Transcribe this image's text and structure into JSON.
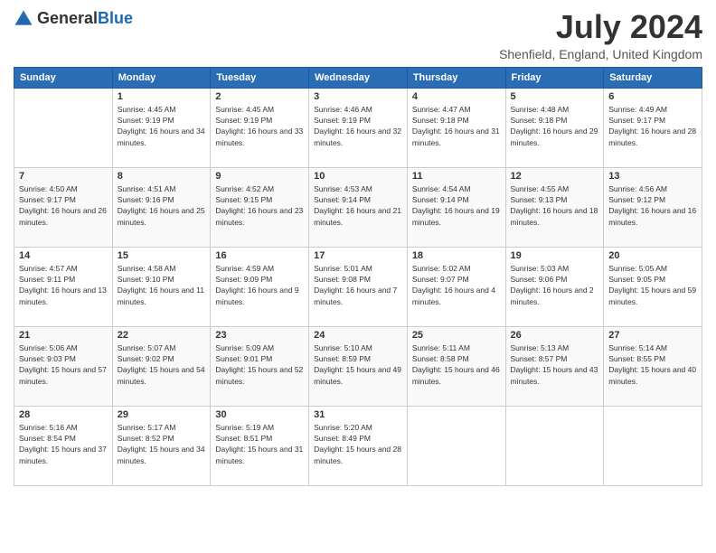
{
  "logo": {
    "general": "General",
    "blue": "Blue"
  },
  "title": "July 2024",
  "location": "Shenfield, England, United Kingdom",
  "headers": [
    "Sunday",
    "Monday",
    "Tuesday",
    "Wednesday",
    "Thursday",
    "Friday",
    "Saturday"
  ],
  "weeks": [
    [
      {
        "day": "",
        "sunrise": "",
        "sunset": "",
        "daylight": ""
      },
      {
        "day": "1",
        "sunrise": "Sunrise: 4:45 AM",
        "sunset": "Sunset: 9:19 PM",
        "daylight": "Daylight: 16 hours and 34 minutes."
      },
      {
        "day": "2",
        "sunrise": "Sunrise: 4:45 AM",
        "sunset": "Sunset: 9:19 PM",
        "daylight": "Daylight: 16 hours and 33 minutes."
      },
      {
        "day": "3",
        "sunrise": "Sunrise: 4:46 AM",
        "sunset": "Sunset: 9:19 PM",
        "daylight": "Daylight: 16 hours and 32 minutes."
      },
      {
        "day": "4",
        "sunrise": "Sunrise: 4:47 AM",
        "sunset": "Sunset: 9:18 PM",
        "daylight": "Daylight: 16 hours and 31 minutes."
      },
      {
        "day": "5",
        "sunrise": "Sunrise: 4:48 AM",
        "sunset": "Sunset: 9:18 PM",
        "daylight": "Daylight: 16 hours and 29 minutes."
      },
      {
        "day": "6",
        "sunrise": "Sunrise: 4:49 AM",
        "sunset": "Sunset: 9:17 PM",
        "daylight": "Daylight: 16 hours and 28 minutes."
      }
    ],
    [
      {
        "day": "7",
        "sunrise": "Sunrise: 4:50 AM",
        "sunset": "Sunset: 9:17 PM",
        "daylight": "Daylight: 16 hours and 26 minutes."
      },
      {
        "day": "8",
        "sunrise": "Sunrise: 4:51 AM",
        "sunset": "Sunset: 9:16 PM",
        "daylight": "Daylight: 16 hours and 25 minutes."
      },
      {
        "day": "9",
        "sunrise": "Sunrise: 4:52 AM",
        "sunset": "Sunset: 9:15 PM",
        "daylight": "Daylight: 16 hours and 23 minutes."
      },
      {
        "day": "10",
        "sunrise": "Sunrise: 4:53 AM",
        "sunset": "Sunset: 9:14 PM",
        "daylight": "Daylight: 16 hours and 21 minutes."
      },
      {
        "day": "11",
        "sunrise": "Sunrise: 4:54 AM",
        "sunset": "Sunset: 9:14 PM",
        "daylight": "Daylight: 16 hours and 19 minutes."
      },
      {
        "day": "12",
        "sunrise": "Sunrise: 4:55 AM",
        "sunset": "Sunset: 9:13 PM",
        "daylight": "Daylight: 16 hours and 18 minutes."
      },
      {
        "day": "13",
        "sunrise": "Sunrise: 4:56 AM",
        "sunset": "Sunset: 9:12 PM",
        "daylight": "Daylight: 16 hours and 16 minutes."
      }
    ],
    [
      {
        "day": "14",
        "sunrise": "Sunrise: 4:57 AM",
        "sunset": "Sunset: 9:11 PM",
        "daylight": "Daylight: 16 hours and 13 minutes."
      },
      {
        "day": "15",
        "sunrise": "Sunrise: 4:58 AM",
        "sunset": "Sunset: 9:10 PM",
        "daylight": "Daylight: 16 hours and 11 minutes."
      },
      {
        "day": "16",
        "sunrise": "Sunrise: 4:59 AM",
        "sunset": "Sunset: 9:09 PM",
        "daylight": "Daylight: 16 hours and 9 minutes."
      },
      {
        "day": "17",
        "sunrise": "Sunrise: 5:01 AM",
        "sunset": "Sunset: 9:08 PM",
        "daylight": "Daylight: 16 hours and 7 minutes."
      },
      {
        "day": "18",
        "sunrise": "Sunrise: 5:02 AM",
        "sunset": "Sunset: 9:07 PM",
        "daylight": "Daylight: 16 hours and 4 minutes."
      },
      {
        "day": "19",
        "sunrise": "Sunrise: 5:03 AM",
        "sunset": "Sunset: 9:06 PM",
        "daylight": "Daylight: 16 hours and 2 minutes."
      },
      {
        "day": "20",
        "sunrise": "Sunrise: 5:05 AM",
        "sunset": "Sunset: 9:05 PM",
        "daylight": "Daylight: 15 hours and 59 minutes."
      }
    ],
    [
      {
        "day": "21",
        "sunrise": "Sunrise: 5:06 AM",
        "sunset": "Sunset: 9:03 PM",
        "daylight": "Daylight: 15 hours and 57 minutes."
      },
      {
        "day": "22",
        "sunrise": "Sunrise: 5:07 AM",
        "sunset": "Sunset: 9:02 PM",
        "daylight": "Daylight: 15 hours and 54 minutes."
      },
      {
        "day": "23",
        "sunrise": "Sunrise: 5:09 AM",
        "sunset": "Sunset: 9:01 PM",
        "daylight": "Daylight: 15 hours and 52 minutes."
      },
      {
        "day": "24",
        "sunrise": "Sunrise: 5:10 AM",
        "sunset": "Sunset: 8:59 PM",
        "daylight": "Daylight: 15 hours and 49 minutes."
      },
      {
        "day": "25",
        "sunrise": "Sunrise: 5:11 AM",
        "sunset": "Sunset: 8:58 PM",
        "daylight": "Daylight: 15 hours and 46 minutes."
      },
      {
        "day": "26",
        "sunrise": "Sunrise: 5:13 AM",
        "sunset": "Sunset: 8:57 PM",
        "daylight": "Daylight: 15 hours and 43 minutes."
      },
      {
        "day": "27",
        "sunrise": "Sunrise: 5:14 AM",
        "sunset": "Sunset: 8:55 PM",
        "daylight": "Daylight: 15 hours and 40 minutes."
      }
    ],
    [
      {
        "day": "28",
        "sunrise": "Sunrise: 5:16 AM",
        "sunset": "Sunset: 8:54 PM",
        "daylight": "Daylight: 15 hours and 37 minutes."
      },
      {
        "day": "29",
        "sunrise": "Sunrise: 5:17 AM",
        "sunset": "Sunset: 8:52 PM",
        "daylight": "Daylight: 15 hours and 34 minutes."
      },
      {
        "day": "30",
        "sunrise": "Sunrise: 5:19 AM",
        "sunset": "Sunset: 8:51 PM",
        "daylight": "Daylight: 15 hours and 31 minutes."
      },
      {
        "day": "31",
        "sunrise": "Sunrise: 5:20 AM",
        "sunset": "Sunset: 8:49 PM",
        "daylight": "Daylight: 15 hours and 28 minutes."
      },
      {
        "day": "",
        "sunrise": "",
        "sunset": "",
        "daylight": ""
      },
      {
        "day": "",
        "sunrise": "",
        "sunset": "",
        "daylight": ""
      },
      {
        "day": "",
        "sunrise": "",
        "sunset": "",
        "daylight": ""
      }
    ]
  ]
}
